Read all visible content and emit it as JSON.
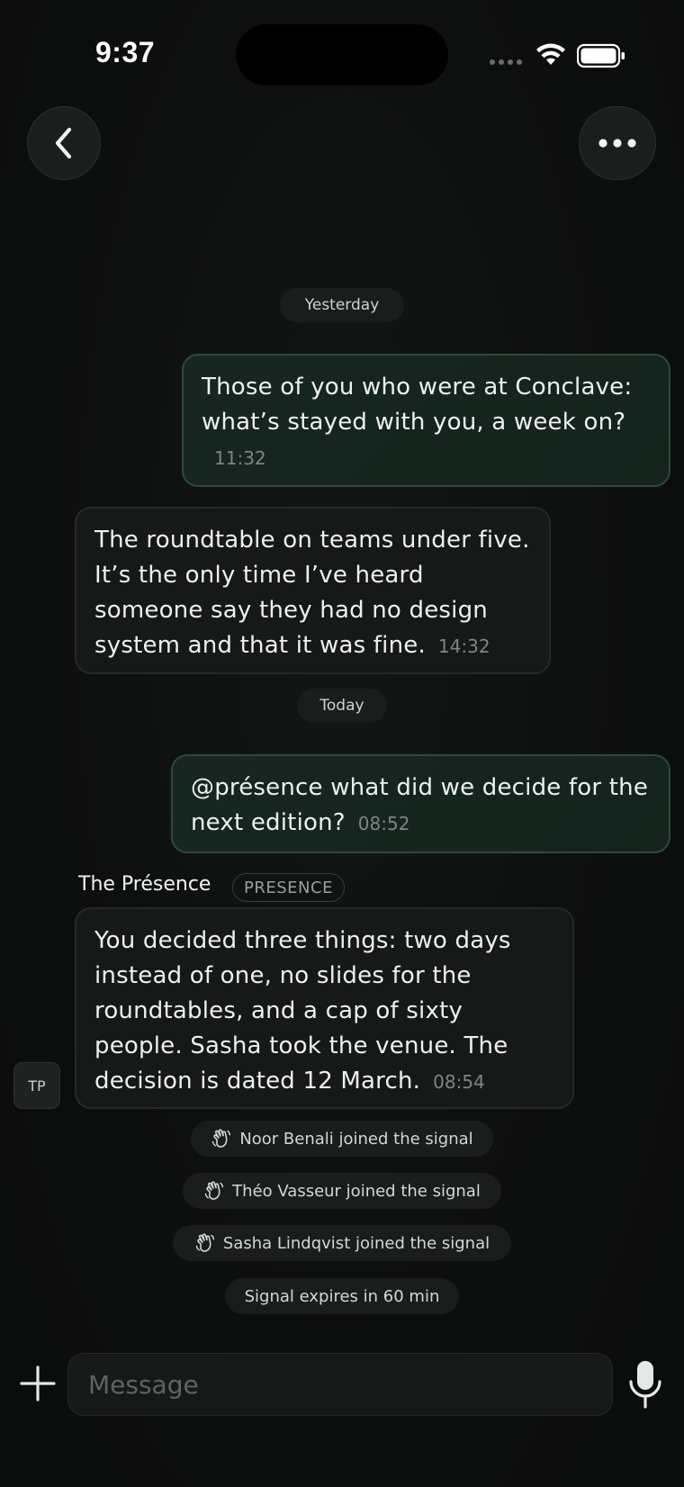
{
  "status_bar": {
    "time": "9:37"
  },
  "header": {
    "back_icon": "chevron-left-icon",
    "more_icon": "more-horizontal-icon"
  },
  "dates": {
    "yesterday": "Yesterday",
    "today": "Today"
  },
  "messages": [
    {
      "direction": "outgoing",
      "text": "Those of you who were at Conclave: what’s stayed with you, a week on?",
      "time": "11:32"
    },
    {
      "direction": "incoming",
      "text": "The roundtable on teams under five. It’s the only time I’ve heard someone say they had no design system and that it was fine.",
      "time": "14:32"
    },
    {
      "direction": "outgoing",
      "text": "@présence what did we decide for the next edition?",
      "time": "08:52"
    },
    {
      "direction": "incoming",
      "sender": "The Présence",
      "badge": "PRESENCE",
      "avatar": "TP",
      "text": "You decided three things: two days instead of one, no slides for the roundtables, and a cap of sixty people. Sasha took the venue. The decision is dated 12 March.",
      "time": "08:54"
    }
  ],
  "events": [
    {
      "icon": "wave-hand-icon",
      "text": "Noor Benali joined the signal"
    },
    {
      "icon": "wave-hand-icon",
      "text": "Théo Vasseur joined the signal"
    },
    {
      "icon": "wave-hand-icon",
      "text": "Sasha Lindqvist joined the signal"
    }
  ],
  "expiry_notice": "Signal expires in 60 min",
  "composer": {
    "placeholder": "Message",
    "value": "",
    "plus_icon": "plus-icon",
    "mic_icon": "microphone-icon"
  },
  "colors": {
    "background": "#0d0e0e",
    "outgoing_bubble": "#172620",
    "outgoing_border": "#2d4a3c",
    "incoming_bubble": "#171919",
    "timestamp": "#7e8583"
  }
}
